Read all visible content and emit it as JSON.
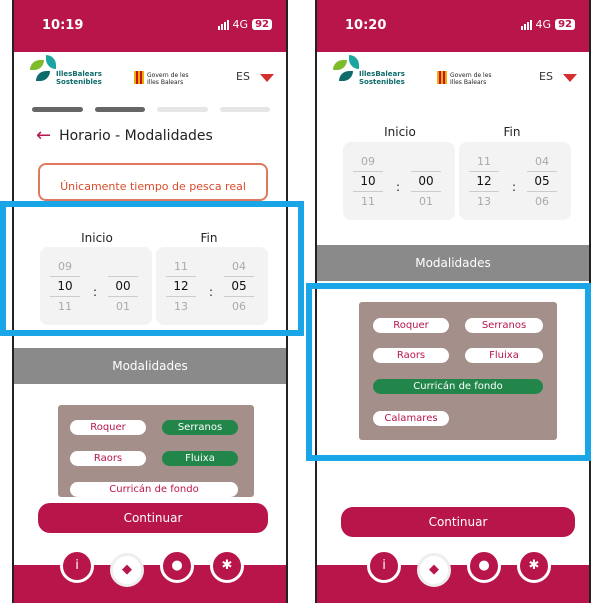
{
  "phone1": {
    "status": {
      "time": "10:19",
      "network": "4G",
      "battery": "92"
    },
    "brand": {
      "line1": "IllesBalears",
      "line2": "Sostenibles"
    },
    "gov": {
      "line1": "Govern de les",
      "line2": "Illes Balears"
    },
    "language": "ES",
    "progress": {
      "total_steps": 4,
      "completed_steps": 2
    },
    "title": "Horario - Modalidades",
    "notice": "Únicamente tiempo de pesca real",
    "inicio_label": "Inicio",
    "fin_label": "Fin",
    "inicio": {
      "hour_prev": "09",
      "hour": "10",
      "hour_next": "11",
      "min_prev": "",
      "min": "00",
      "min_next": "01"
    },
    "fin": {
      "hour_prev": "11",
      "hour": "12",
      "hour_next": "13",
      "min_prev": "04",
      "min": "05",
      "min_next": "06"
    },
    "modalidades_label": "Modalidades",
    "chips": [
      {
        "label": "Roquer",
        "selected": false
      },
      {
        "label": "Serranos",
        "selected": true
      },
      {
        "label": "Raors",
        "selected": false
      },
      {
        "label": "Fluixa",
        "selected": true
      },
      {
        "label": "Curricán de fondo",
        "selected": false
      }
    ],
    "continue": "Continuar"
  },
  "phone2": {
    "status": {
      "time": "10:20",
      "network": "4G",
      "battery": "92"
    },
    "brand": {
      "line1": "IllesBalears",
      "line2": "Sostenibles"
    },
    "gov": {
      "line1": "Govern de les",
      "line2": "Illes Balears"
    },
    "language": "ES",
    "inicio_label": "Inicio",
    "fin_label": "Fin",
    "inicio": {
      "hour_prev": "09",
      "hour": "10",
      "hour_next": "11",
      "min_prev": "",
      "min": "00",
      "min_next": "01"
    },
    "fin": {
      "hour_prev": "11",
      "hour": "12",
      "hour_next": "13",
      "min_prev": "04",
      "min": "05",
      "min_next": "06"
    },
    "modalidades_label": "Modalidades",
    "chips": [
      {
        "label": "Roquer",
        "selected": false
      },
      {
        "label": "Serranos",
        "selected": false
      },
      {
        "label": "Raors",
        "selected": false
      },
      {
        "label": "Fluixa",
        "selected": false
      },
      {
        "label": "Curricán de fondo",
        "selected": true
      },
      {
        "label": "Calamares",
        "selected": false
      }
    ],
    "continue": "Continuar"
  },
  "nav_icons": [
    "info-icon",
    "fish-icon",
    "user-icon",
    "gear-icon"
  ],
  "colors": {
    "brand": "#b8154a",
    "selected_chip": "#22864a",
    "highlight": "#1aa5e6",
    "notice": "#d84b2a",
    "panel": "#a58f8a",
    "section": "#8a8a8a"
  }
}
